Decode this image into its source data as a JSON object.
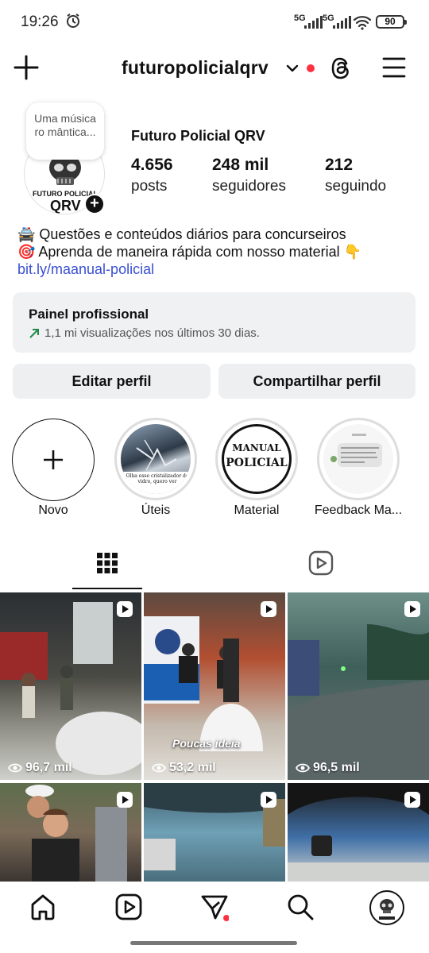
{
  "status_bar": {
    "time": "19:26",
    "network_1": "5G",
    "network_2": "5G",
    "battery": "90"
  },
  "header": {
    "username": "futuropolicialqrv",
    "icons": [
      "plus-icon",
      "chevron-down-icon",
      "notification-dot",
      "threads-icon",
      "menu-icon"
    ]
  },
  "profile": {
    "note": "Uma música ro mântica...",
    "full_name": "Futuro Policial QRV",
    "posts_count": "4.656",
    "posts_label": "posts",
    "followers_count": "248 mil",
    "followers_label": "seguidores",
    "following_count": "212",
    "following_label": "seguindo",
    "avatar_text_1": "FUTURO POLICIAL",
    "avatar_text_2": "QRV",
    "bio_line_1": "🚔 Questões e conteúdos diários para concurseiros",
    "bio_line_2": "🎯 Aprenda de maneira rápida com nosso material 👇",
    "bio_link": "bit.ly/maanual-policial"
  },
  "professional_panel": {
    "title": "Painel profissional",
    "subtitle": "1,1 mi visualizações nos últimos 30 dias."
  },
  "buttons": {
    "edit": "Editar perfil",
    "share": "Compartilhar perfil"
  },
  "highlights": [
    {
      "label": "Novo"
    },
    {
      "label": "Úteis",
      "caption": "Olha esse cristalizador de vidro, quero ver"
    },
    {
      "label": "Material",
      "cover_line_1": "MANUAL",
      "cover_line_2": "POLICIAL"
    },
    {
      "label": "Feedback Ma..."
    }
  ],
  "posts": [
    {
      "views": "96,7 mil",
      "overlay": ""
    },
    {
      "views": "53,2 mil",
      "overlay": "Poucas ideia"
    },
    {
      "views": "96,5 mil",
      "overlay": ""
    },
    {
      "views": "",
      "overlay": ""
    },
    {
      "views": "",
      "overlay": ""
    },
    {
      "views": "",
      "overlay": ""
    }
  ],
  "colors": {
    "accent_red": "#ff3040",
    "link_blue": "#3a4fd3",
    "panel_bg": "#f0f1f3",
    "trend_green": "#1e8a48"
  }
}
